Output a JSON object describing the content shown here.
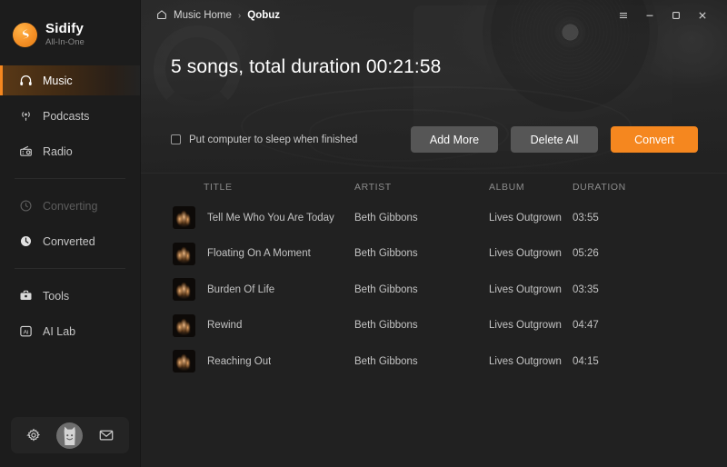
{
  "brand": {
    "name": "Sidify",
    "tagline": "All-In-One",
    "logo_icon": "sidify-bolt-logo",
    "accent_color": "#f5871f"
  },
  "sidebar": {
    "groups": [
      {
        "items": [
          {
            "label": "Music",
            "icon": "headphones-icon",
            "active": true,
            "dimmed": false
          },
          {
            "label": "Podcasts",
            "icon": "podcast-icon",
            "active": false,
            "dimmed": false
          },
          {
            "label": "Radio",
            "icon": "radio-icon",
            "active": false,
            "dimmed": false
          }
        ]
      },
      {
        "items": [
          {
            "label": "Converting",
            "icon": "converting-icon",
            "active": false,
            "dimmed": true
          },
          {
            "label": "Converted",
            "icon": "clock-icon",
            "active": false,
            "dimmed": false
          }
        ]
      },
      {
        "items": [
          {
            "label": "Tools",
            "icon": "toolbox-icon",
            "active": false,
            "dimmed": false
          },
          {
            "label": "AI Lab",
            "icon": "ai-lab-icon",
            "active": false,
            "dimmed": false
          }
        ]
      }
    ],
    "bottom_bar": {
      "settings_icon": "gear-icon",
      "avatar_icon": "user-avatar",
      "feedback_icon": "mail-icon"
    }
  },
  "titlebar": {
    "breadcrumb": {
      "home_icon": "home-icon",
      "home_label": "Music Home",
      "separator": "›",
      "current_label": "Qobuz"
    },
    "window_controls": {
      "menu_icon": "hamburger-menu-icon",
      "minimize_icon": "minimize-icon",
      "maximize_icon": "maximize-icon",
      "close_icon": "close-icon"
    }
  },
  "hero": {
    "title": "5 songs, total duration 00:21:58",
    "sleep_option": {
      "label": "Put computer to sleep when finished",
      "checked": false
    },
    "buttons": {
      "add_more": "Add More",
      "delete_all": "Delete All",
      "convert": "Convert"
    }
  },
  "table": {
    "columns": [
      "TITLE",
      "ARTIST",
      "ALBUM",
      "DURATION"
    ],
    "rows": [
      {
        "title": "Tell Me Who You Are Today",
        "artist": "Beth Gibbons",
        "album": "Lives Outgrown",
        "duration": "03:55"
      },
      {
        "title": "Floating On A Moment",
        "artist": "Beth Gibbons",
        "album": "Lives Outgrown",
        "duration": "05:26"
      },
      {
        "title": "Burden Of Life",
        "artist": "Beth Gibbons",
        "album": "Lives Outgrown",
        "duration": "03:35"
      },
      {
        "title": "Rewind",
        "artist": "Beth Gibbons",
        "album": "Lives Outgrown",
        "duration": "04:47"
      },
      {
        "title": "Reaching Out",
        "artist": "Beth Gibbons",
        "album": "Lives Outgrown",
        "duration": "04:15"
      }
    ]
  }
}
